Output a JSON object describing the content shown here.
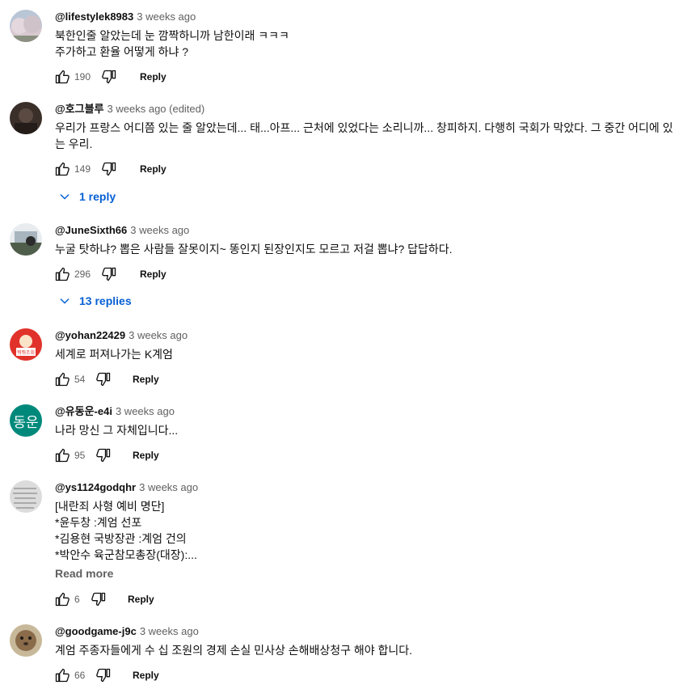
{
  "comments": [
    {
      "handle": "@lifestylek8983",
      "time": "3 weeks ago",
      "lines": [
        "북한인줄 알았는데 눈 깜짝하니까 남한이래 ㅋㅋㅋ",
        "주가하고 환율 어떻게 하냐 ?"
      ],
      "likes": "190",
      "reply_label": "Reply",
      "avatar": "cherry-blossom-photo"
    },
    {
      "handle": "@호그블루",
      "time": "3 weeks ago (edited)",
      "lines": [
        "우리가 프랑스 어디쯤 있는 줄 알았는데... 태...아프... 근처에 있었다는 소리니까... 창피하지. 다행히 국회가 막았다. 그 중간 어디에 있",
        "는 우리."
      ],
      "likes": "149",
      "reply_label": "Reply",
      "replies_label": "1 reply",
      "avatar": "dark-portrait-photo"
    },
    {
      "handle": "@JuneSixth66",
      "time": "3 weeks ago",
      "lines": [
        "누굴 탓하냐? 뽑은 사람들 잘못이지~ 똥인지 된장인지도 모르고 저걸 뽑냐? 답답하다."
      ],
      "likes": "296",
      "reply_label": "Reply",
      "replies_label": "13 replies",
      "avatar": "scenery-photo"
    },
    {
      "handle": "@yohan22429",
      "time": "3 weeks ago",
      "lines": [
        "세계로 퍼져나가는 K계엄"
      ],
      "likes": "54",
      "reply_label": "Reply",
      "avatar": "red-cartoon-logo",
      "avatar_text": "뭐뭐조회"
    },
    {
      "handle": "@유동운-e4i",
      "time": "3 weeks ago",
      "lines": [
        "나라 망신 그 자체입니다..."
      ],
      "likes": "95",
      "reply_label": "Reply",
      "avatar": "initials",
      "avatar_text": "동운",
      "avatar_color": "#00897b"
    },
    {
      "handle": "@ys1124godqhr",
      "time": "3 weeks ago",
      "lines": [
        "[내란죄 사형 예비 명단]",
        "*윤두창 :계엄 선포",
        "*김용현 국방장관 :계엄 건의",
        "*박안수 육군참모총장(대장):..."
      ],
      "readmore_label": "Read more",
      "likes": "6",
      "reply_label": "Reply",
      "avatar": "handwriting-photo"
    },
    {
      "handle": "@goodgame-j9c",
      "time": "3 weeks ago",
      "lines": [
        "계엄 주종자들에게 수 십 조원의 경제 손실 민사상 손해배상청구 해야 합니다."
      ],
      "likes": "66",
      "reply_label": "Reply",
      "avatar": "quokka-photo"
    }
  ]
}
